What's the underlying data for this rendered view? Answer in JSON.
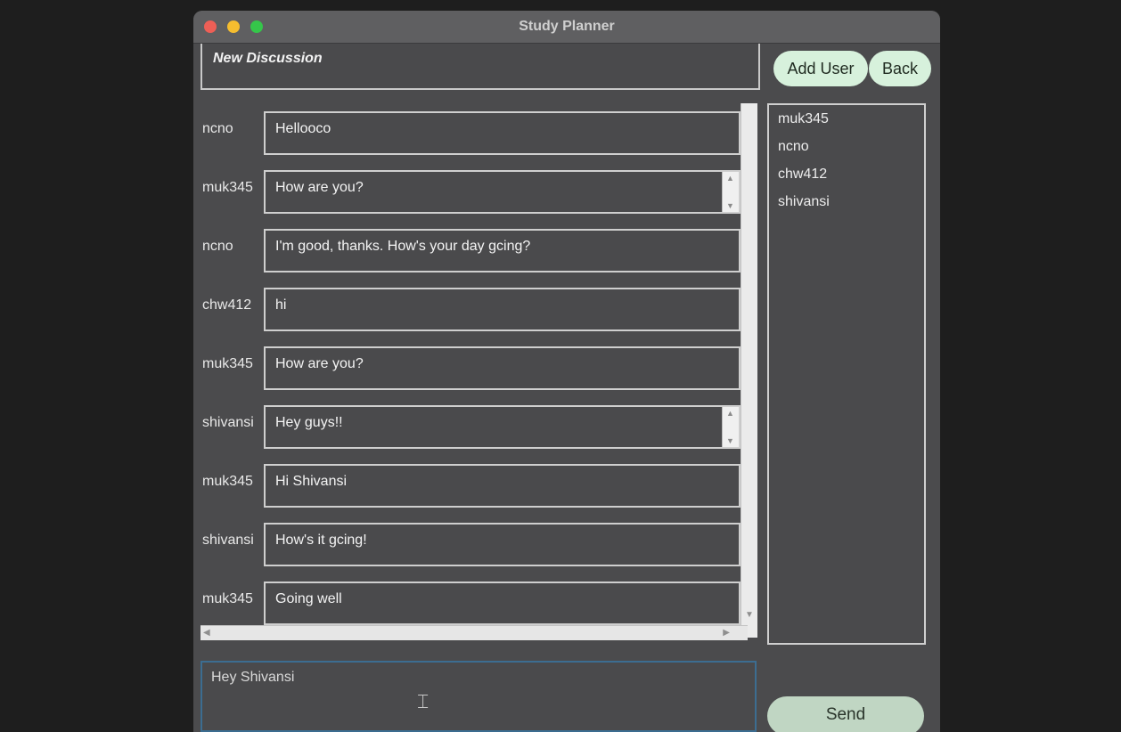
{
  "window": {
    "title": "Study Planner"
  },
  "discussion": {
    "title": "New Discussion"
  },
  "buttons": {
    "add_user": "Add User",
    "back": "Back",
    "send": "Send"
  },
  "messages": [
    {
      "user": "ncno",
      "text": "Hellooco",
      "has_scroll": false
    },
    {
      "user": "muk345",
      "text": "How are you?",
      "has_scroll": true
    },
    {
      "user": "ncno",
      "text": "I'm good, thanks. How's your day gcing?",
      "has_scroll": false
    },
    {
      "user": "chw412",
      "text": "hi",
      "has_scroll": false
    },
    {
      "user": "muk345",
      "text": "How are you?",
      "has_scroll": false
    },
    {
      "user": "shivansi",
      "text": "Hey guys!!",
      "has_scroll": true
    },
    {
      "user": "muk345",
      "text": "Hi Shivansi",
      "has_scroll": false
    },
    {
      "user": "shivansi",
      "text": "How's it gcing!",
      "has_scroll": false
    },
    {
      "user": "muk345",
      "text": "Going well",
      "has_scroll": false
    }
  ],
  "users": [
    "muk345",
    "ncno",
    "chw412",
    "shivansi"
  ],
  "compose": {
    "value": "Hey Shivansi"
  },
  "icons": {
    "cursor": "text-cursor-icon"
  }
}
